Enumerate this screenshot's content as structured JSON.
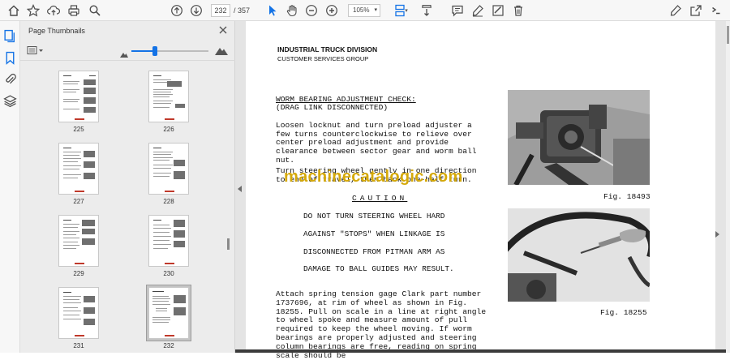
{
  "toolbar": {
    "current_page": "232",
    "page_total": "/ 357",
    "zoom": "105%"
  },
  "panel": {
    "title": "Page Thumbnails",
    "zoom_level": 0.3
  },
  "thumbnails": [
    {
      "num": "225"
    },
    {
      "num": "226"
    },
    {
      "num": "227"
    },
    {
      "num": "228"
    },
    {
      "num": "229"
    },
    {
      "num": "230"
    },
    {
      "num": "231"
    },
    {
      "num": "232"
    }
  ],
  "document": {
    "header_line1": "INDUSTRIAL TRUCK DIVISION",
    "header_line2": "CUSTOMER SERVICES GROUP",
    "title": "WORM BEARING ADJUSTMENT CHECK:",
    "subtitle": "(DRAG LINK DISCONNECTED)",
    "para1": "Loosen locknut and turn preload adjuster a few turns counterclockwise to relieve over center preload adjustment and provide clearance between sector gear and worm ball nut.",
    "para2": "Turn steering wheel gently in one direction to end of travel, then back one-half turn.",
    "caution_heading": "CAUTION",
    "caution_lines": [
      "DO NOT TURN STEERING WHEEL HARD",
      "AGAINST \"STOPS\" WHEN LINKAGE IS",
      "DISCONNECTED FROM PITMAN ARM AS",
      "DAMAGE TO BALL GUIDES MAY RESULT."
    ],
    "para3": "Attach spring tension gage Clark part number 1737696, at rim of wheel as shown in Fig. 18255. Pull on scale in a line at right angle to wheel spoke and measure amount of pull required to keep the wheel moving. If worm bearings are properly adjusted and steering column bearings are free, reading on spring scale should be",
    "fig1_label": "Fig. 18493",
    "fig2_label": "Fig. 18255",
    "watermark": "machinecatalogic.com"
  }
}
